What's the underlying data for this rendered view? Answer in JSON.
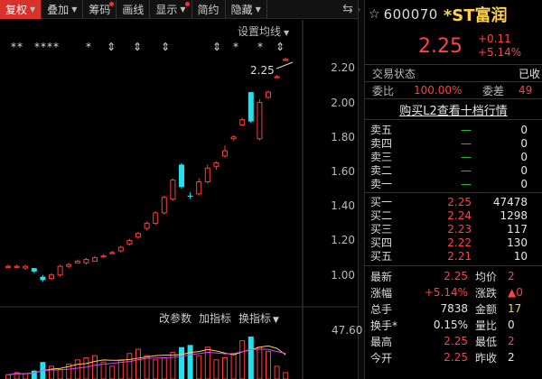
{
  "toolbar": {
    "items": [
      {
        "label": "复权",
        "has_arrow": true,
        "active": true,
        "dot": false
      },
      {
        "label": "叠加",
        "has_arrow": true,
        "active": false,
        "dot": false
      },
      {
        "label": "筹码",
        "has_arrow": false,
        "active": false,
        "dot": true
      },
      {
        "label": "画线",
        "has_arrow": false,
        "active": false,
        "dot": false
      },
      {
        "label": "显示",
        "has_arrow": true,
        "active": false,
        "dot": true
      },
      {
        "label": "简约",
        "has_arrow": false,
        "active": false,
        "dot": false
      },
      {
        "label": "隐藏",
        "has_arrow": true,
        "active": false,
        "dot": false
      }
    ],
    "more_icon": "⇆"
  },
  "chart": {
    "setting_ma": "设置均线",
    "annotation": "2.25",
    "price_ticks": [
      "2.20",
      "2.00",
      "1.80",
      "1.60",
      "1.40",
      "1.20",
      "1.00"
    ],
    "markers_text": "** **** * ⇕ ⇕ ⇕ ⇕ * * ⇕",
    "indicator_toolbar": {
      "params": "改参数",
      "add": "加指标",
      "switch": "换指标"
    },
    "volume_top": "47.60"
  },
  "chart_data": {
    "type": "candlestick",
    "ylim": [
      0.92,
      2.27
    ],
    "candles": [
      {
        "open": 1.05,
        "close": 1.05,
        "high": 1.06,
        "low": 1.04,
        "up": true
      },
      {
        "open": 1.05,
        "close": 1.05,
        "high": 1.06,
        "low": 1.04,
        "up": true
      },
      {
        "open": 1.04,
        "close": 1.05,
        "high": 1.06,
        "low": 1.03,
        "up": true
      },
      {
        "open": 1.04,
        "close": 1.02,
        "high": 1.04,
        "low": 1.01,
        "up": false
      },
      {
        "open": 0.99,
        "close": 0.97,
        "high": 1.0,
        "low": 0.96,
        "up": false
      },
      {
        "open": 0.98,
        "close": 1.0,
        "high": 1.01,
        "low": 0.97,
        "up": true
      },
      {
        "open": 1.0,
        "close": 1.05,
        "high": 1.06,
        "low": 0.99,
        "up": true
      },
      {
        "open": 1.05,
        "close": 1.06,
        "high": 1.07,
        "low": 1.04,
        "up": true
      },
      {
        "open": 1.07,
        "close": 1.08,
        "high": 1.09,
        "low": 1.07,
        "up": true
      },
      {
        "open": 1.07,
        "close": 1.09,
        "high": 1.1,
        "low": 1.06,
        "up": true
      },
      {
        "open": 1.08,
        "close": 1.1,
        "high": 1.11,
        "low": 1.08,
        "up": true
      },
      {
        "open": 1.11,
        "close": 1.11,
        "high": 1.12,
        "low": 1.1,
        "up": true
      },
      {
        "open": 1.13,
        "close": 1.13,
        "high": 1.14,
        "low": 1.12,
        "up": true
      },
      {
        "open": 1.14,
        "close": 1.16,
        "high": 1.17,
        "low": 1.13,
        "up": true
      },
      {
        "open": 1.18,
        "close": 1.2,
        "high": 1.21,
        "low": 1.17,
        "up": true
      },
      {
        "open": 1.22,
        "close": 1.24,
        "high": 1.25,
        "low": 1.21,
        "up": true
      },
      {
        "open": 1.27,
        "close": 1.3,
        "high": 1.31,
        "low": 1.26,
        "up": true
      },
      {
        "open": 1.3,
        "close": 1.36,
        "high": 1.37,
        "low": 1.29,
        "up": true
      },
      {
        "open": 1.36,
        "close": 1.45,
        "high": 1.46,
        "low": 1.35,
        "up": true
      },
      {
        "open": 1.44,
        "close": 1.55,
        "high": 1.56,
        "low": 1.43,
        "up": true
      },
      {
        "open": 1.64,
        "close": 1.51,
        "high": 1.65,
        "low": 1.5,
        "up": false
      },
      {
        "open": 1.46,
        "close": 1.46,
        "high": 1.48,
        "low": 1.44,
        "up": false
      },
      {
        "open": 1.47,
        "close": 1.54,
        "high": 1.56,
        "low": 1.46,
        "up": true
      },
      {
        "open": 1.54,
        "close": 1.62,
        "high": 1.64,
        "low": 1.53,
        "up": true
      },
      {
        "open": 1.63,
        "close": 1.65,
        "high": 1.66,
        "low": 1.61,
        "up": true
      },
      {
        "open": 1.69,
        "close": 1.72,
        "high": 1.75,
        "low": 1.68,
        "up": true
      },
      {
        "open": 1.79,
        "close": 1.8,
        "high": 1.81,
        "low": 1.78,
        "up": true
      },
      {
        "open": 1.87,
        "close": 1.9,
        "high": 1.91,
        "low": 1.86,
        "up": true
      },
      {
        "open": 2.06,
        "close": 1.89,
        "high": 2.06,
        "low": 1.88,
        "up": false
      },
      {
        "open": 1.79,
        "close": 2.0,
        "high": 2.02,
        "low": 1.78,
        "up": true
      },
      {
        "open": 2.03,
        "close": 2.06,
        "high": 2.07,
        "low": 2.02,
        "up": true
      },
      {
        "open": 2.15,
        "close": 2.15,
        "high": 2.16,
        "low": 2.14,
        "up": true
      },
      {
        "open": 2.25,
        "close": 2.25,
        "high": 2.26,
        "low": 2.24,
        "up": true
      }
    ],
    "volume": {
      "ylim": [
        0,
        47.6
      ],
      "values": [
        4,
        6,
        5,
        8,
        16,
        12,
        9,
        14,
        18,
        20,
        22,
        16,
        12,
        18,
        24,
        28,
        22,
        18,
        20,
        25,
        30,
        32,
        22,
        30,
        18,
        20,
        24,
        36,
        40,
        30,
        26,
        12,
        6
      ],
      "up": [
        true,
        true,
        true,
        false,
        false,
        true,
        true,
        true,
        true,
        true,
        true,
        true,
        true,
        true,
        true,
        true,
        true,
        true,
        true,
        true,
        false,
        false,
        true,
        true,
        true,
        true,
        true,
        true,
        false,
        true,
        true,
        true,
        true
      ]
    }
  },
  "quote": {
    "star": "☆",
    "code": "600070",
    "name": "*ST富润",
    "price": "2.25",
    "change": "+0.11",
    "change_pct": "+5.14%",
    "trade_status_label": "交易状态",
    "trade_status_value": "已收",
    "weibi_label": "委比",
    "weibi_value": "100.00%",
    "weicha_label": "委差",
    "weicha_value": "49",
    "l2_link": "购买L2查看十档行情",
    "asks": [
      {
        "name": "卖五",
        "price": "—",
        "vol": "0"
      },
      {
        "name": "卖四",
        "price": "—",
        "vol": "0"
      },
      {
        "name": "卖三",
        "price": "—",
        "vol": "0"
      },
      {
        "name": "卖二",
        "price": "—",
        "vol": "0"
      },
      {
        "name": "卖一",
        "price": "—",
        "vol": "0"
      }
    ],
    "bids": [
      {
        "name": "买一",
        "price": "2.25",
        "vol": "47478"
      },
      {
        "name": "买二",
        "price": "2.24",
        "vol": "1298"
      },
      {
        "name": "买三",
        "price": "2.23",
        "vol": "117"
      },
      {
        "name": "买四",
        "price": "2.22",
        "vol": "130"
      },
      {
        "name": "买五",
        "price": "2.21",
        "vol": "10"
      }
    ],
    "stats": [
      {
        "l1": "最新",
        "v1": "2.25",
        "c1": "red",
        "l2": "均价",
        "v2": "2",
        "c2": "red"
      },
      {
        "l1": "涨幅",
        "v1": "+5.14%",
        "c1": "red",
        "l2": "涨跌",
        "v2": "▲0",
        "c2": "red"
      },
      {
        "l1": "总手",
        "v1": "7838",
        "c1": "white",
        "l2": "金额",
        "v2": "17",
        "c2": "yellow"
      },
      {
        "l1": "换手*",
        "v1": "0.15%",
        "c1": "white",
        "l2": "量比",
        "v2": "0",
        "c2": "white"
      },
      {
        "l1": "最高",
        "v1": "2.25",
        "c1": "red",
        "l2": "最低",
        "v2": "2",
        "c2": "red"
      },
      {
        "l1": "今开",
        "v1": "2.25",
        "c1": "red",
        "l2": "昨收",
        "v2": "2",
        "c2": "white"
      }
    ]
  }
}
